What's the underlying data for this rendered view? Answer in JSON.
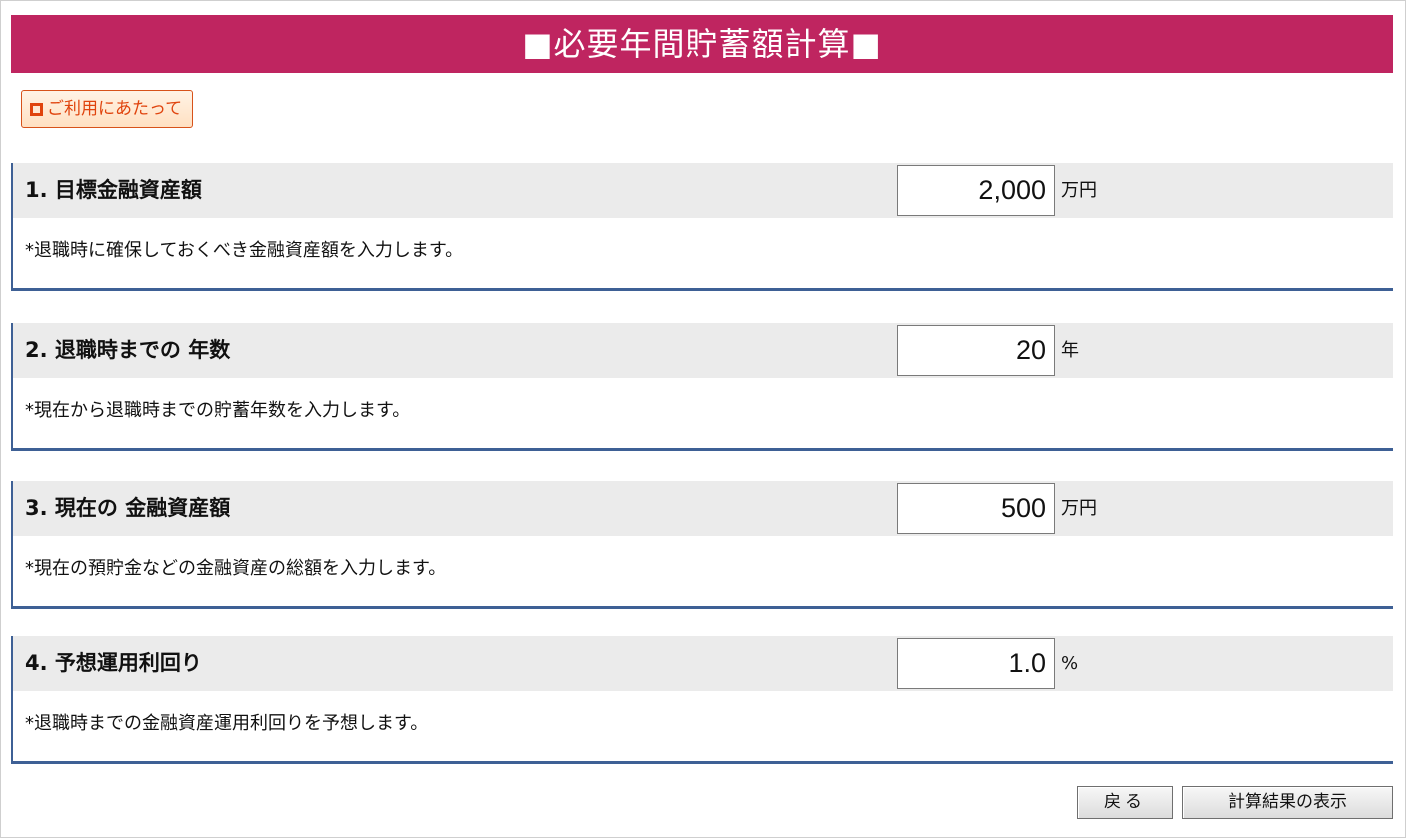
{
  "header": {
    "title": "■必要年間貯蓄額計算■"
  },
  "guide": {
    "label": "ご利用にあたって",
    "icon": "external-link-icon"
  },
  "sections": [
    {
      "label": "1. 目標金融資産額",
      "value": "2,000",
      "unit": "万円",
      "description": "*退職時に確保しておくべき金融資産額を入力します。"
    },
    {
      "label": "2. 退職時までの 年数",
      "value": "20",
      "unit": "年",
      "description": "*現在から退職時までの貯蓄年数を入力します。"
    },
    {
      "label": "3. 現在の 金融資産額",
      "value": "500",
      "unit": "万円",
      "description": "*現在の預貯金などの金融資産の総額を入力します。"
    },
    {
      "label": "4. 予想運用利回り",
      "value": "1.0",
      "unit": "%",
      "description": "*退職時までの金融資産運用利回りを予想します。"
    }
  ],
  "buttons": {
    "back_label": "戻る",
    "show_result_label": "計算結果の表示"
  },
  "colors": {
    "title_bar": "#bf2560",
    "section_border": "#3e6095",
    "guide_accent": "#e0440e"
  }
}
